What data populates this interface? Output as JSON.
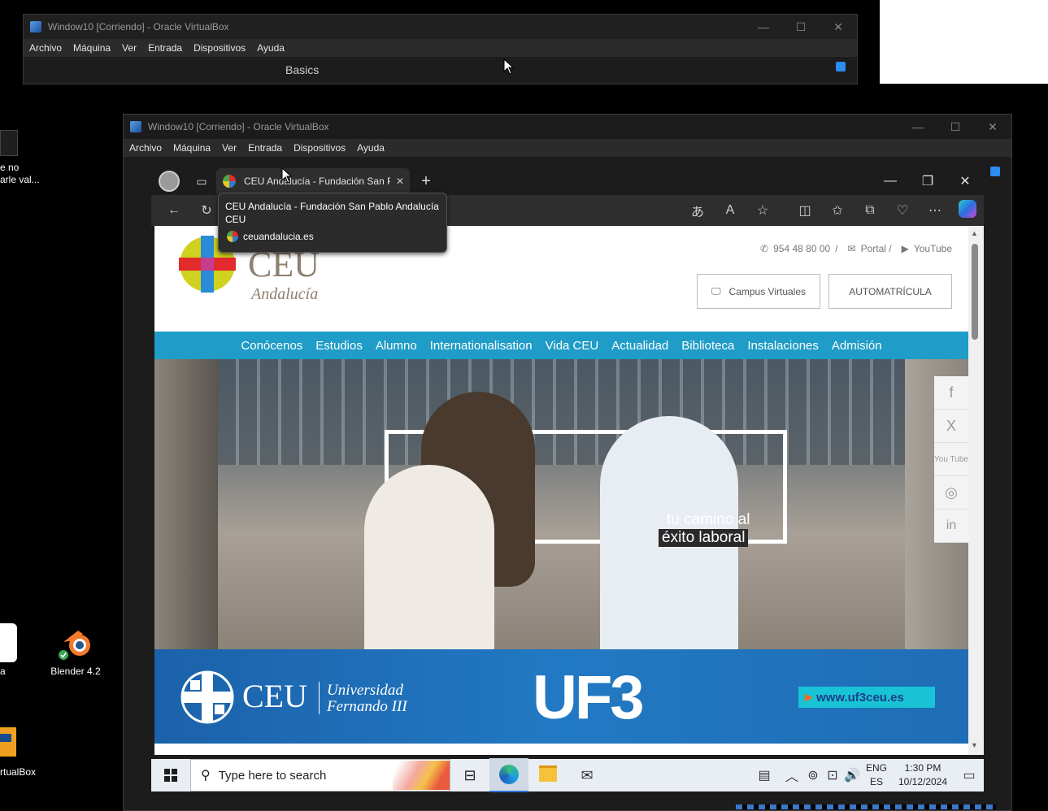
{
  "back_window": {
    "title": "Window10 [Corriendo] - Oracle VirtualBox",
    "menu": [
      "Archivo",
      "Máquina",
      "Ver",
      "Entrada",
      "Dispositivos",
      "Ayuda"
    ],
    "content_label": "Basics"
  },
  "desktop": {
    "frag_text_1": "e no",
    "frag_text_2": "arle val...",
    "blender_label": "Blender 4.2",
    "left_label": "a",
    "vbox_label": "rtualBox"
  },
  "front_window": {
    "title": "Window10 [Corriendo] - Oracle VirtualBox",
    "menu": [
      "Archivo",
      "Máquina",
      "Ver",
      "Entrada",
      "Dispositivos",
      "Ayuda"
    ]
  },
  "browser": {
    "tab_title": "CEU Andalucía - Fundación San P",
    "tooltip_title": "CEU Andalucía - Fundación San Pablo Andalucía CEU",
    "tooltip_url": "ceuandalucia.es"
  },
  "site": {
    "logo_text": "CEU",
    "logo_sub": "Andalucía",
    "phone": "954 48 80 00",
    "sep1": "/",
    "portal": "Portal /",
    "youtube": "YouTube",
    "campus_btn": "Campus Virtuales",
    "auto_btn": "AUTOMATRÍCULA",
    "nav": [
      "Conócenos",
      "Estudios",
      "Alumno",
      "Internationalisation",
      "Vida CEU",
      "Actualidad",
      "Biblioteca",
      "Instalaciones",
      "Admisión"
    ],
    "hero_text_1": "tu camino al",
    "hero_text_2": "éxito laboral",
    "banner_ceu": "CEU",
    "banner_univ_1": "Universidad",
    "banner_univ_2": "Fernando III",
    "banner_uf3": "UF3",
    "banner_url": "www.uf3ceu.es",
    "social": [
      "f",
      "X",
      "You Tube",
      "◎",
      "in"
    ]
  },
  "taskbar": {
    "search_placeholder": "Type here to search",
    "lang_1": "ENG",
    "lang_2": "ES",
    "time": "1:30 PM",
    "date": "10/12/2024"
  },
  "colors": {
    "nav_blue": "#1f9cc7",
    "banner_blue": "#1f6db5",
    "cyan_btn": "#19c3d6"
  }
}
